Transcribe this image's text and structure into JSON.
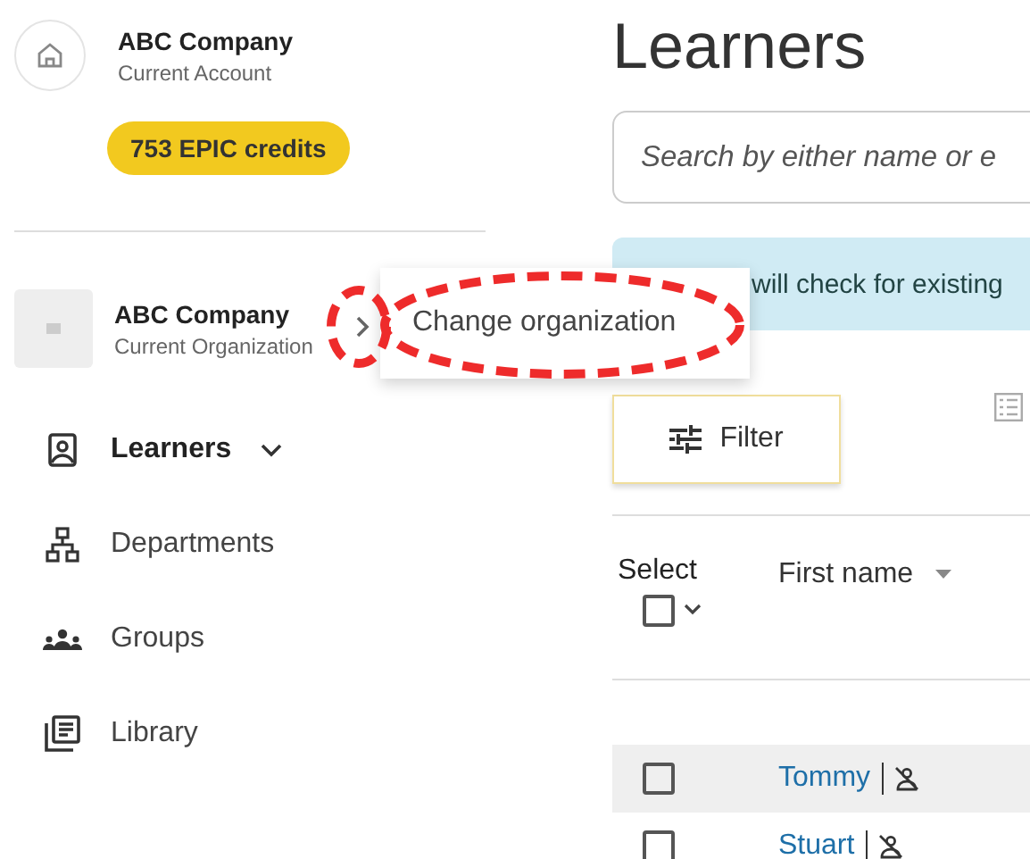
{
  "account": {
    "name": "ABC Company",
    "role": "Current Account",
    "credits": "753 EPIC credits"
  },
  "organization": {
    "name": "ABC Company",
    "role": "Current Organization"
  },
  "tooltip": {
    "text": "Change organization"
  },
  "annotations": [
    {
      "kind": "ellipse"
    },
    {
      "kind": "ellipse"
    }
  ],
  "nav": [
    {
      "kind": "learners",
      "label": "Learners",
      "selected": true,
      "expandable": true
    },
    {
      "kind": "departments",
      "label": "Departments",
      "selected": false,
      "expandable": false
    },
    {
      "kind": "groups",
      "label": "Groups",
      "selected": false,
      "expandable": false
    },
    {
      "kind": "library",
      "label": "Library",
      "selected": false,
      "expandable": false
    }
  ],
  "page": {
    "title": "Learners",
    "search": {
      "placeholder": "Search by either name or e"
    },
    "notice": "will check for existing",
    "filter": "Filter"
  },
  "table": {
    "columns": [
      {
        "kind": "select",
        "label": "Select",
        "checked": false
      },
      {
        "kind": "sort",
        "label": "First name"
      }
    ],
    "rows": [
      {
        "first_name": "Tommy",
        "checked": false,
        "highlighted": true
      },
      {
        "first_name": "Stuart",
        "checked": false,
        "highlighted": false
      }
    ]
  }
}
